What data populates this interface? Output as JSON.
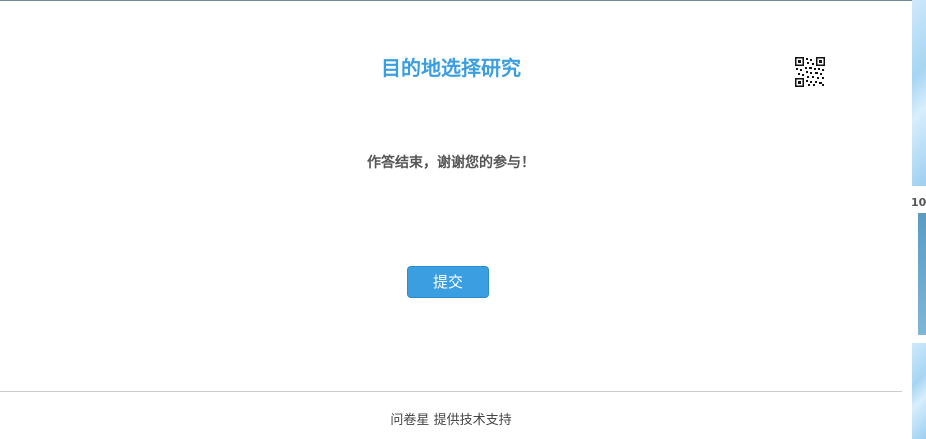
{
  "survey": {
    "title": "目的地选择研究",
    "end_message": "作答结束，谢谢您的参与！",
    "submit_label": "提交"
  },
  "footer": {
    "brand": "问卷星",
    "text": "提供技术支持"
  },
  "side_panel": {
    "label": "10"
  },
  "colors": {
    "accent": "#3a9ee0",
    "text": "#555555",
    "footer_text": "#444444"
  },
  "icons": {
    "qr": "qr-code-icon"
  }
}
